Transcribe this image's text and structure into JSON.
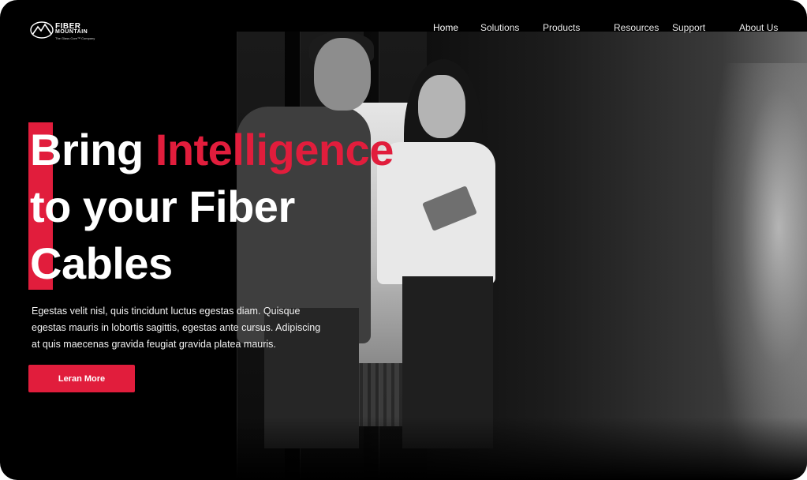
{
  "brand": {
    "name_line1": "FIBER",
    "name_line2": "MOUNTAIN",
    "tagline": "The Glass Core™ Company",
    "accent_color": "#e11d3c"
  },
  "nav": {
    "items": [
      {
        "label": "Home",
        "active": true
      },
      {
        "label": "Solutions",
        "active": false
      },
      {
        "label": "Products",
        "active": false
      },
      {
        "label": "Resources",
        "active": false
      },
      {
        "label": "Support",
        "active": false
      },
      {
        "label": "About Us",
        "active": false
      }
    ]
  },
  "hero": {
    "headline_part1": "Bring ",
    "headline_highlight": "Intelligence",
    "headline_line2": "to your Fiber",
    "headline_line3": "Cables",
    "description": "Egestas velit nisl, quis tincidunt luctus egestas diam. Quisque egestas mauris in lobortis sagittis, egestas ante cursus. Adipiscing at quis maecenas gravida feugiat gravida platea mauris.",
    "cta_label": "Leran More"
  },
  "icons": {
    "logo": "mountain-logo-icon"
  }
}
